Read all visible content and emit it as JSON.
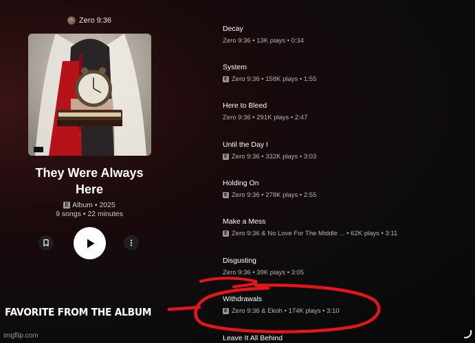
{
  "album": {
    "artist": "Zero 9:36",
    "title_line1": "They Were Always",
    "title_line2": "Here",
    "type_year": "Album • 2025",
    "explicit_badge": "E",
    "songs_duration": "9 songs • 22 minutes"
  },
  "tracks": [
    {
      "title": "Decay",
      "explicit": false,
      "explicit_badge": "",
      "subtitle": "Zero 9:36 • 13K plays • 0:34"
    },
    {
      "title": "System",
      "explicit": true,
      "explicit_badge": "E",
      "subtitle": "Zero 9:36 • 158K plays • 1:55"
    },
    {
      "title": "Here to Bleed",
      "explicit": false,
      "explicit_badge": "",
      "subtitle": "Zero 9:36 • 291K plays • 2:47"
    },
    {
      "title": "Until the Day I",
      "explicit": true,
      "explicit_badge": "E",
      "subtitle": "Zero 9:36 • 332K plays • 3:03"
    },
    {
      "title": "Holding On",
      "explicit": true,
      "explicit_badge": "E",
      "subtitle": "Zero 9:36 • 278K plays • 2:55"
    },
    {
      "title": "Make a Mess",
      "explicit": true,
      "explicit_badge": "E",
      "subtitle": "Zero 9:36 & No Love For The Middle ...  • 62K plays • 3:11"
    },
    {
      "title": "Disgusting",
      "explicit": false,
      "explicit_badge": "",
      "subtitle": "Zero 9:36 • 39K plays • 3:05"
    },
    {
      "title": "Withdrawals",
      "explicit": true,
      "explicit_badge": "E",
      "subtitle": "Zero 9:36 & Ekoh • 174K plays • 3:10"
    },
    {
      "title": "Leave It All Behind",
      "explicit": false,
      "explicit_badge": "",
      "subtitle": ""
    }
  ],
  "annotation": {
    "label": "FAVORITE FROM THE ALBUM",
    "color": "#e8141c"
  },
  "watermark": "imgflip.com",
  "controls": {
    "bookmark_icon": "bookmark-icon",
    "play_icon": "play-icon",
    "more_icon": "more-vertical-icon"
  }
}
